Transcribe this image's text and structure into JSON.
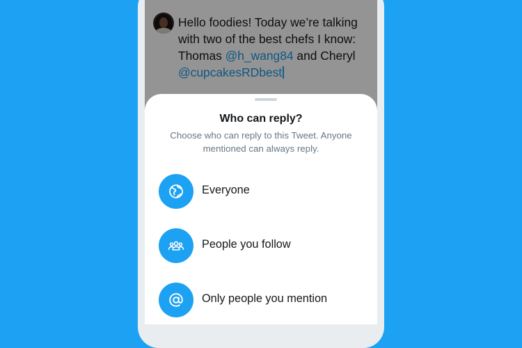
{
  "tweet": {
    "text_line1": "Hello foodies! Today we’re talking",
    "text_line2": "with two of the best chefs I know:",
    "text_line3_pre": "Thomas ",
    "mention_1": "@h_wang84",
    "text_line3_mid": " and Cheryl",
    "mention_2": "@cupcakesRDbest"
  },
  "reply_sheet": {
    "title": "Who can reply?",
    "subtitle": "Choose who can reply to this Tweet. Anyone mentioned can always reply.",
    "options": [
      {
        "label": "Everyone",
        "icon": "globe-icon"
      },
      {
        "label": "People you follow",
        "icon": "people-icon"
      },
      {
        "label": "Only people you mention",
        "icon": "at-sign-icon"
      }
    ]
  },
  "colors": {
    "background": "#1DA1F2",
    "accent": "#1DA1F2",
    "mention": "#1B95E0",
    "text_primary": "#14171A",
    "text_secondary": "#657786"
  }
}
